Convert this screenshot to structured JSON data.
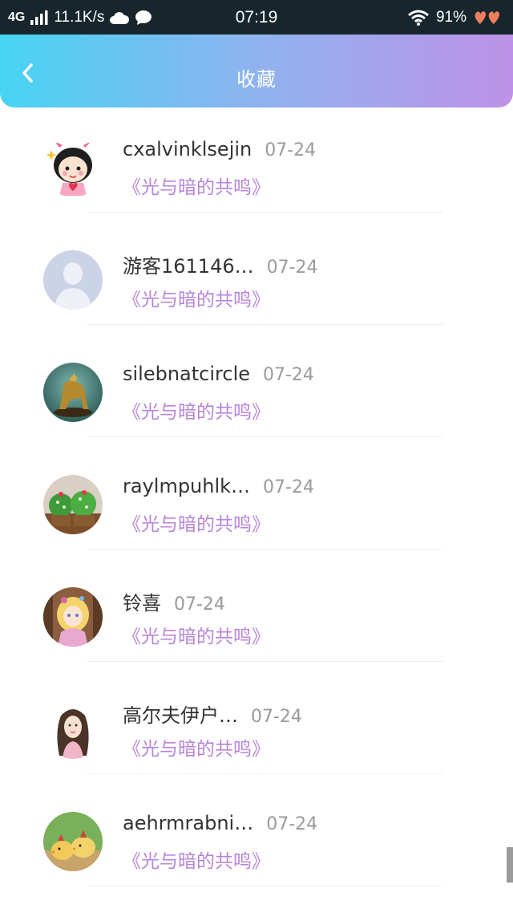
{
  "status_bar": {
    "network": "4G",
    "speed": "11.1K/s",
    "time": "07:19",
    "battery": "91%"
  },
  "header": {
    "title": "收藏",
    "back_icon": "chevron-left-icon"
  },
  "colors": {
    "header_gradient_start": "#47d4f2",
    "header_gradient_end": "#be92e6",
    "title_accent": "#b784d9",
    "status_bar_bg": "#16262c"
  },
  "favorites": [
    {
      "username": "cxalvinklsejin",
      "date": "07-24",
      "title": "《光与暗的共鸣》",
      "avatar": "cartoon-girl-avatar"
    },
    {
      "username": "游客161146…",
      "date": "07-24",
      "title": "《光与暗的共鸣》",
      "avatar": "default-user-avatar"
    },
    {
      "username": "silebnatcircle",
      "date": "07-24",
      "title": "《光与暗的共鸣》",
      "avatar": "horse-statue-avatar"
    },
    {
      "username": "raylmpuhlk…",
      "date": "07-24",
      "title": "《光与暗的共鸣》",
      "avatar": "cupcakes-avatar"
    },
    {
      "username": "铃喜",
      "date": "07-24",
      "title": "《光与暗的共鸣》",
      "avatar": "anime-girl-avatar"
    },
    {
      "username": "高尔夫伊户…",
      "date": "07-24",
      "title": "《光与暗的共鸣》",
      "avatar": "illustrated-woman-avatar"
    },
    {
      "username": "aehrmrabni…",
      "date": "07-24",
      "title": "《光与暗的共鸣》",
      "avatar": "chicks-avatar"
    }
  ]
}
